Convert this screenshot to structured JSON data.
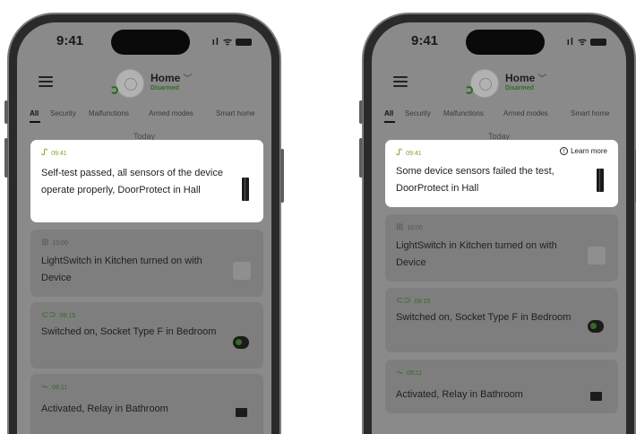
{
  "screens": [
    {
      "status_time": "9:41",
      "signal_icons": "ıl ᯤ",
      "home_title": "Home",
      "home_status": "Disarmed",
      "tabs": [
        "All",
        "Security",
        "Malfunctions",
        "Armed modes",
        "Smart home"
      ],
      "day_label": "Today",
      "events": [
        {
          "time": "09:41",
          "icon": "self-test-icon",
          "text": "Self-test passed, all sensors of the device operate properly, DoorProtect in Hall",
          "highlighted": true
        },
        {
          "time": "10:00",
          "icon": "light-switch-icon",
          "text": "LightSwitch in Kitchen turned on with Device",
          "highlighted": false
        },
        {
          "time": "09:15",
          "icon": "socket-icon",
          "text": "Switched on, Socket Type F in Bedroom",
          "highlighted": false
        },
        {
          "time": "06:11",
          "icon": "relay-icon",
          "text": "Activated, Relay in Bathroom",
          "highlighted": false
        }
      ]
    },
    {
      "status_time": "9:41",
      "signal_icons": "ıl ᯤ",
      "home_title": "Home",
      "home_status": "Disarmed",
      "tabs": [
        "All",
        "Security",
        "Malfunctions",
        "Armed modes",
        "Smart home"
      ],
      "day_label": "Today",
      "learn_more": "Learn more",
      "events": [
        {
          "time": "09:41",
          "icon": "self-test-icon",
          "text": "Some device sensors failed the test, DoorProtect in Hall",
          "highlighted": true
        },
        {
          "time": "10:00",
          "icon": "light-switch-icon",
          "text": "LightSwitch in Kitchen turned on with Device",
          "highlighted": false
        },
        {
          "time": "09:15",
          "icon": "socket-icon",
          "text": "Switched on, Socket Type F in Bedroom",
          "highlighted": false
        },
        {
          "time": "06:11",
          "icon": "relay-icon",
          "text": "Activated, Relay in Bathroom",
          "highlighted": false
        }
      ]
    }
  ],
  "colors": {
    "accent_green": "#356b22",
    "highlight_time": "#7aa62a",
    "dim_overlay": "#8a8a8a"
  }
}
